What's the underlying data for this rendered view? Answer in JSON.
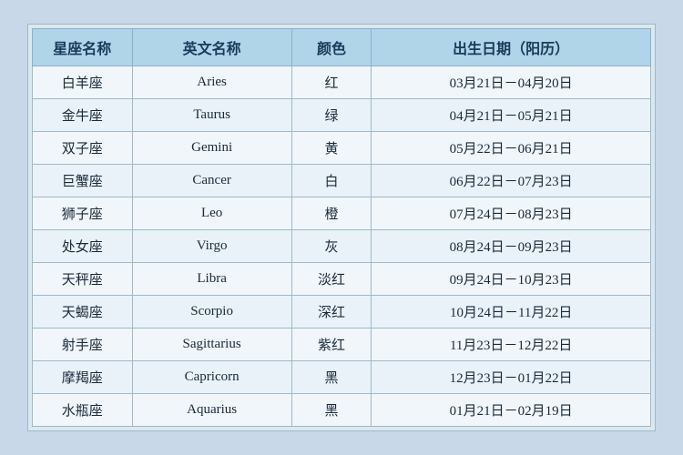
{
  "table": {
    "headers": {
      "col1": "星座名称",
      "col2": "英文名称",
      "col3": "颜色",
      "col4": "出生日期（阳历）"
    },
    "rows": [
      {
        "chinese": "白羊座",
        "english": "Aries",
        "color": "红",
        "date": "03月21日－04月20日"
      },
      {
        "chinese": "金牛座",
        "english": "Taurus",
        "color": "绿",
        "date": "04月21日－05月21日"
      },
      {
        "chinese": "双子座",
        "english": "Gemini",
        "color": "黄",
        "date": "05月22日－06月21日"
      },
      {
        "chinese": "巨蟹座",
        "english": "Cancer",
        "color": "白",
        "date": "06月22日－07月23日"
      },
      {
        "chinese": "狮子座",
        "english": "Leo",
        "color": "橙",
        "date": "07月24日－08月23日"
      },
      {
        "chinese": "处女座",
        "english": "Virgo",
        "color": "灰",
        "date": "08月24日－09月23日"
      },
      {
        "chinese": "天秤座",
        "english": "Libra",
        "color": "淡红",
        "date": "09月24日－10月23日"
      },
      {
        "chinese": "天蝎座",
        "english": "Scorpio",
        "color": "深红",
        "date": "10月24日－11月22日"
      },
      {
        "chinese": "射手座",
        "english": "Sagittarius",
        "color": "紫红",
        "date": "11月23日－12月22日"
      },
      {
        "chinese": "摩羯座",
        "english": "Capricorn",
        "color": "黑",
        "date": "12月23日－01月22日"
      },
      {
        "chinese": "水瓶座",
        "english": "Aquarius",
        "color": "黑",
        "date": "01月21日－02月19日"
      }
    ]
  }
}
